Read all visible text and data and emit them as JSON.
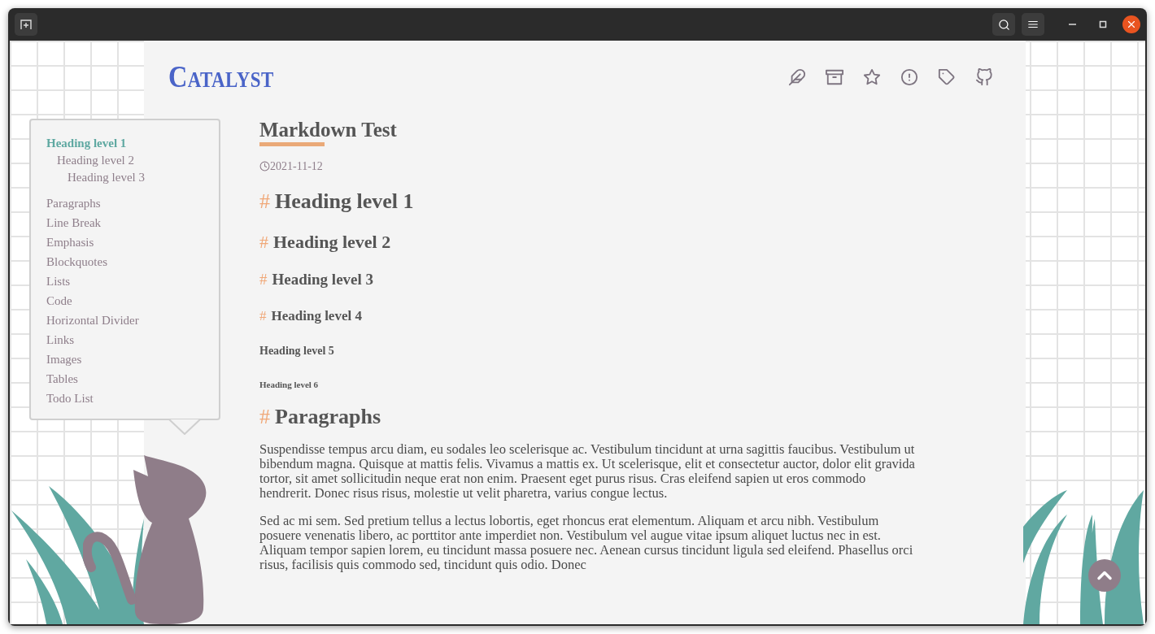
{
  "site": {
    "logo": "Catalyst"
  },
  "toc": [
    {
      "label": "Heading level 1",
      "selected": true,
      "children": [
        {
          "label": "Heading level 2",
          "selected": false,
          "children": [
            {
              "label": "Heading level 3",
              "selected": false
            }
          ]
        }
      ]
    },
    {
      "label": "Paragraphs",
      "selected": false
    },
    {
      "label": "Line Break",
      "selected": false
    },
    {
      "label": "Emphasis",
      "selected": false
    },
    {
      "label": "Blockquotes",
      "selected": false
    },
    {
      "label": "Lists",
      "selected": false
    },
    {
      "label": "Code",
      "selected": false
    },
    {
      "label": "Horizontal Divider",
      "selected": false
    },
    {
      "label": "Links",
      "selected": false
    },
    {
      "label": "Images",
      "selected": false
    },
    {
      "label": "Tables",
      "selected": false
    },
    {
      "label": "Todo List",
      "selected": false
    }
  ],
  "article": {
    "title": "Markdown Test",
    "date": "2021-11-12",
    "blocks": [
      {
        "kind": "h1",
        "anchor": "#",
        "text": "Heading level 1"
      },
      {
        "kind": "h2",
        "anchor": "#",
        "text": "Heading level 2"
      },
      {
        "kind": "h3",
        "anchor": "#",
        "text": "Heading level 3"
      },
      {
        "kind": "h4",
        "anchor": "#",
        "text": "Heading level 4"
      },
      {
        "kind": "h5",
        "text": "Heading level 5"
      },
      {
        "kind": "h6",
        "text": "Heading level 6"
      },
      {
        "kind": "h1",
        "anchor": "#",
        "text": "Paragraphs"
      },
      {
        "kind": "p",
        "text": "Suspendisse tempus arcu diam, eu sodales leo scelerisque ac. Vestibulum tincidunt at urna sagittis faucibus. Vestibulum ut bibendum magna. Quisque at mattis felis. Vivamus a mattis ex. Ut scelerisque, elit et consectetur auctor, dolor elit gravida tortor, sit amet sollicitudin neque erat non enim. Praesent eget purus risus. Cras eleifend sapien ut eros commodo hendrerit. Donec risus risus, molestie ut velit pharetra, varius congue lectus."
      },
      {
        "kind": "p",
        "text": "Sed ac mi sem. Sed pretium tellus a lectus lobortis, eget rhoncus erat elementum. Aliquam et arcu nibh. Vestibulum posuere venenatis libero, ac porttitor ante imperdiet non. Vestibulum vel augue vitae ipsum aliquet luctus nec in est. Aliquam tempor sapien lorem, eu tincidunt massa posuere nec. Aenean cursus tincidunt ligula sed eleifend. Phasellus orci risus, facilisis quis commodo sed, tincidunt quis odio. Donec"
      }
    ]
  }
}
